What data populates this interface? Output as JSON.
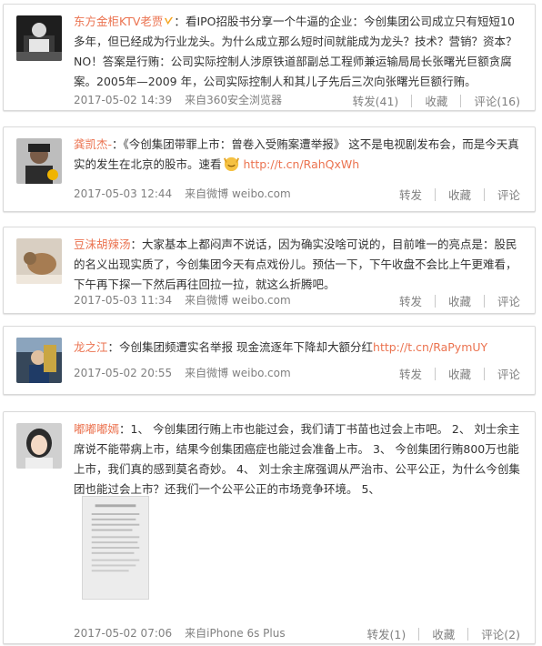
{
  "posts": [
    {
      "user": "东方金柜KTV老贾",
      "prefix": "：",
      "text": "看IPO招股书分享一个牛逼的企业：今创集团公司成立只有短短10多年，但已经成为行业龙头。为什么成立那么短时间就能成为龙头？技术？营销？资本？NO！答案是行贿：公司实际控制人涉原铁道部副总工程师兼运输局局长张曙光巨额贪腐案。2005年—2009 年，公司实际控制人和其儿子先后三次向张曙光巨额行贿。",
      "time": "2017-05-02 14:39",
      "source": "来自360安全浏览器",
      "repost": "转发(41)",
      "favorite": "收藏",
      "comment": "评论(16)"
    },
    {
      "user": "龚凯杰-",
      "prefix": "：",
      "text": "《今创集团带罪上市：曾卷入受贿案遭举报》 这不是电视剧发布会，而是今天真实的发生在北京的股市。速看",
      "url": "http://t.cn/RahQxWh",
      "time": "2017-05-03 12:44",
      "source": "来自微博 weibo.com",
      "repost": "转发",
      "favorite": "收藏",
      "comment": "评论"
    },
    {
      "user": "豆沫胡辣汤",
      "prefix": "：",
      "text": "大家基本上都闷声不说话，因为确实没啥可说的，目前唯一的亮点是：股民的名义出现实质了，今创集团今天有点戏份儿。预估一下，下午收盘不会比上午更难看，下午再下探一下然后再往回拉一拉，就这么折腾吧。",
      "time": "2017-05-03 11:34",
      "source": "来自微博 weibo.com",
      "repost": "转发",
      "favorite": "收藏",
      "comment": "评论"
    },
    {
      "user": "龙之江",
      "prefix": "：",
      "text": "今创集团频遭实名举报 现金流逐年下降却大额分红",
      "url": "http://t.cn/RaPymUY",
      "time": "2017-05-02 20:55",
      "source": "来自微博 weibo.com",
      "repost": "转发",
      "favorite": "收藏",
      "comment": "评论"
    },
    {
      "user": "嘟嘟嘟嫣",
      "prefix": "：",
      "text": "1、 今创集团行贿上市也能过会，我们请丁书苗也过会上市吧。 2、 刘士余主席说不能带病上市，结果今创集团癌症也能过会准备上市。 3、 今创集团行贿800万也能上市，我们真的感到莫名奇妙。 4、 刘士余主席强调从严治市、公平公正，为什么今创集团也能过会上市？还我们一个公平公正的市场竞争环境。 5、",
      "time": "2017-05-02 07:06",
      "source": "来自iPhone 6s Plus",
      "repost": "转发(1)",
      "favorite": "收藏",
      "comment": "评论(2)"
    }
  ],
  "colors": {
    "username": "#eb7350",
    "link": "#eb7350",
    "meta": "#808080",
    "text": "#333333"
  },
  "icons": [
    "avatar",
    "verified-badge-icon",
    "emoji-icon",
    "attached-image-thumbnail"
  ]
}
